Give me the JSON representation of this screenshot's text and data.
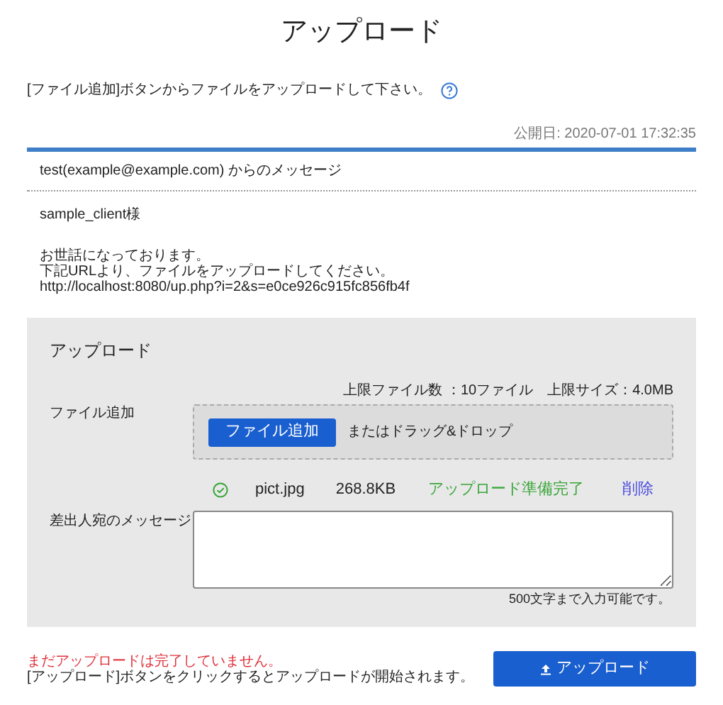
{
  "title": "アップロード",
  "instruction": "[ファイル追加]ボタンからファイルをアップロードして下さい。",
  "published": "公開日: 2020-07-01 17:32:35",
  "sender": "test(example@example.com) からのメッセージ",
  "recipient": "sample_client様",
  "message_lines": [
    "お世話になっております。",
    "下記URLより、ファイルをアップロードしてください。",
    "http://localhost:8080/up.php?i=2&s=e0ce926c915fc856fb4f"
  ],
  "panel": {
    "heading": "アップロード",
    "file_label": "ファイル追加",
    "limits": "上限ファイル数 ：10ファイル　上限サイズ：4.0MB",
    "add_button": "ファイル追加",
    "drop_hint": "またはドラッグ&ドロップ",
    "files": [
      {
        "name": "pict.jpg",
        "size": "268.8KB",
        "status": "アップロード準備完了",
        "ready": true,
        "delete": "削除"
      }
    ],
    "message_label": "差出人宛のメッセージ",
    "message_note": "500文字まで入力可能です。"
  },
  "footer": {
    "warning": "まだアップロードは完了していません。",
    "hint": "[アップロード]ボタンをクリックするとアップロードが開始されます。",
    "upload_button": "アップロード"
  }
}
